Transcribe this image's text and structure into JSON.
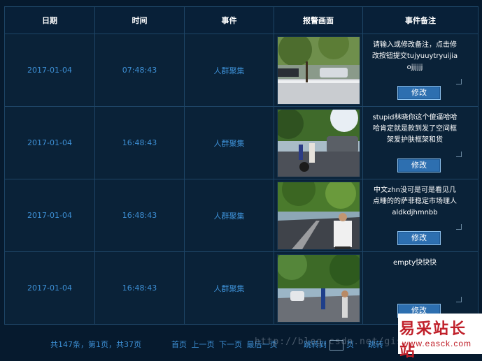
{
  "headers": {
    "date": "日期",
    "time": "时间",
    "event": "事件",
    "alarm_image": "报警画面",
    "remark": "事件备注"
  },
  "rows": [
    {
      "date": "2017-01-04",
      "time": "07:48:43",
      "event": "人群聚集",
      "remark": "请输入或修改备注，点击修改按钮提交tujyuuytryuijiaojjjjjj",
      "button": "修改"
    },
    {
      "date": "2017-01-04",
      "time": "16:48:43",
      "event": "人群聚集",
      "remark": "stupid林晓你这个傻逼哈哈哈肯定就是款到发了空间框架爱护肤框架和货",
      "button": "修改"
    },
    {
      "date": "2017-01-04",
      "time": "16:48:43",
      "event": "人群聚集",
      "remark": "中文zhn没可是可是看见几点睡的的萨菲稳定市场理人aldkdjhmnbb",
      "button": "修改"
    },
    {
      "date": "2017-01-04",
      "time": "16:48:43",
      "event": "人群聚集",
      "remark": "empty快快快",
      "button": "修改"
    }
  ],
  "pager": {
    "summary": "共147条，第1页，共37页",
    "first": "首页",
    "prev": "上一页",
    "next": "下一页",
    "last": "最后一页",
    "jump_to": "跳转到",
    "page_unit": "页",
    "go": "跳转"
  },
  "watermark": "http://blog.csdn.net/gis",
  "logo": {
    "title": "易采站长站",
    "url": "www.easck.com"
  },
  "colors": {
    "background": "#061a2e",
    "link": "#3d8fd4",
    "button": "#2d6fb0",
    "logo": "#c0202a"
  }
}
